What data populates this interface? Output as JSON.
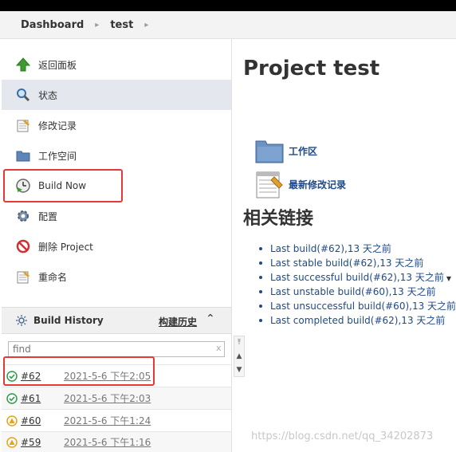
{
  "breadcrumb": {
    "items": [
      "Dashboard",
      "test"
    ]
  },
  "sidebar": {
    "tasks": [
      {
        "label": "返回面板",
        "icon": "up-arrow-icon"
      },
      {
        "label": "状态",
        "icon": "search-icon"
      },
      {
        "label": "修改记录",
        "icon": "notepad-icon"
      },
      {
        "label": "工作空间",
        "icon": "folder-icon"
      },
      {
        "label": "Build Now",
        "icon": "clock-play-icon"
      },
      {
        "label": "配置",
        "icon": "gear-icon"
      },
      {
        "label": "删除 Project",
        "icon": "no-entry-icon"
      },
      {
        "label": "重命名",
        "icon": "notepad-icon"
      }
    ]
  },
  "build_history": {
    "title": "Build History",
    "trend_label": "构建历史",
    "find_placeholder": "find",
    "clear_label": "x",
    "builds": [
      {
        "number": "#62",
        "time": "2021-5-6 下午2:05",
        "status": "success"
      },
      {
        "number": "#61",
        "time": "2021-5-6 下午2:03",
        "status": "success"
      },
      {
        "number": "#60",
        "time": "2021-5-6 下午1:24",
        "status": "unstable"
      },
      {
        "number": "#59",
        "time": "2021-5-6 下午1:16",
        "status": "unstable"
      }
    ]
  },
  "main": {
    "title": "Project test",
    "workspace_label": "工作区",
    "changes_label": "最新修改记录",
    "permalinks_title": "相关链接",
    "permalinks": [
      "Last build(#62),13 天之前",
      "Last stable build(#62),13 天之前",
      "Last successful build(#62),13 天之前",
      "Last unstable build(#60),13 天之前",
      "Last unsuccessful build(#60),13 天之前",
      "Last completed build(#62),13 天之前"
    ]
  },
  "watermark": "https://blog.csdn.net/qq_34202873",
  "colors": {
    "success": "#2e9c4a",
    "unstable": "#e8a317",
    "link": "#204a87",
    "highlight": "#e53935"
  }
}
